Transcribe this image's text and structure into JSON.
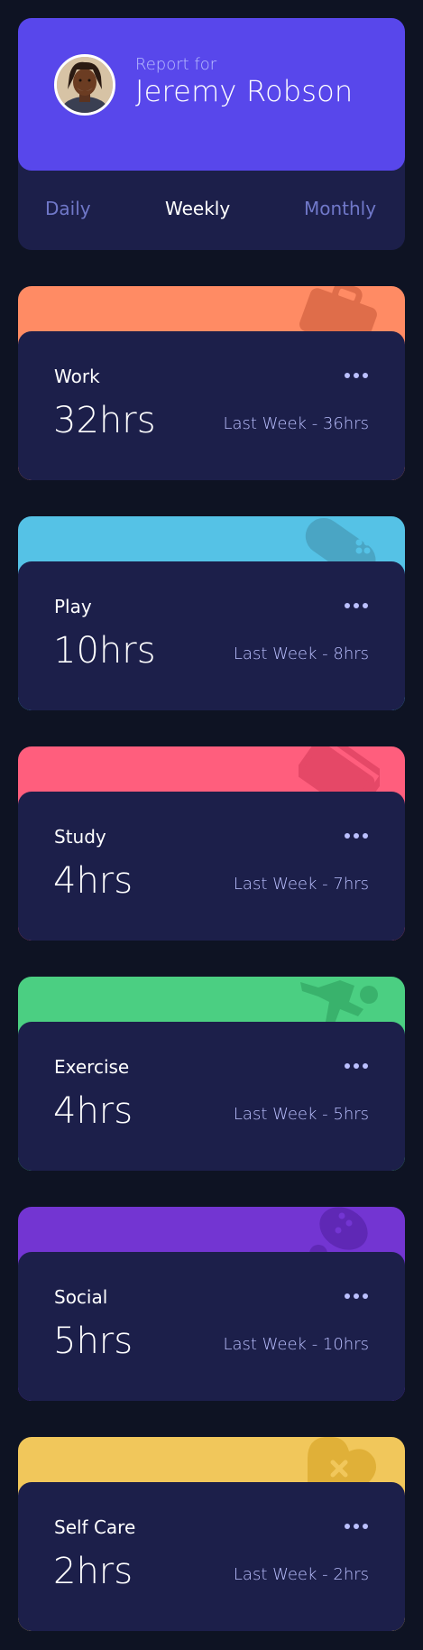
{
  "profile": {
    "report_for": "Report for",
    "name": "Jeremy Robson",
    "tabs": [
      {
        "label": "Daily",
        "active": false
      },
      {
        "label": "Weekly",
        "active": true
      },
      {
        "label": "Monthly",
        "active": false
      }
    ]
  },
  "activities": [
    {
      "title": "Work",
      "current": "32hrs",
      "previous": "Last Week - 36hrs",
      "color": "#ff8b64",
      "icon": "briefcase-icon",
      "icon_color": "#df6d4a"
    },
    {
      "title": "Play",
      "current": "10hrs",
      "previous": "Last Week - 8hrs",
      "color": "#55c2e6",
      "icon": "gamepad-icon",
      "icon_color": "#4aa5c4"
    },
    {
      "title": "Study",
      "current": "4hrs",
      "previous": "Last Week - 7hrs",
      "color": "#ff5e7d",
      "icon": "book-icon",
      "icon_color": "#e54867"
    },
    {
      "title": "Exercise",
      "current": "4hrs",
      "previous": "Last Week - 5hrs",
      "color": "#4bcf82",
      "icon": "running-icon",
      "icon_color": "#39b26c"
    },
    {
      "title": "Social",
      "current": "5hrs",
      "previous": "Last Week - 10hrs",
      "color": "#7335d2",
      "icon": "balloon-icon",
      "icon_color": "#5f28b5"
    },
    {
      "title": "Self Care",
      "current": "2hrs",
      "previous": "Last Week - 2hrs",
      "color": "#f1c75b",
      "icon": "heart-icon",
      "icon_color": "#e0b038"
    }
  ]
}
